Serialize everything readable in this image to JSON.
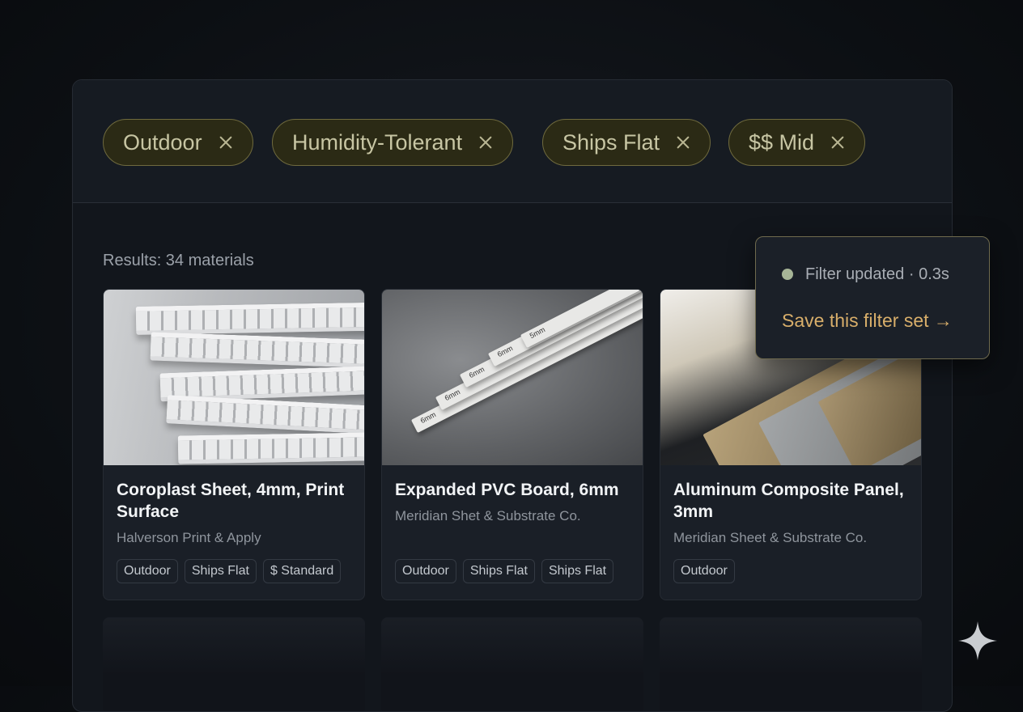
{
  "filters": {
    "chips": [
      {
        "label": "Outdoor"
      },
      {
        "label": "Humidity-Tolerant"
      },
      {
        "label": "Ships Flat"
      },
      {
        "label": "$$ Mid"
      }
    ]
  },
  "results": {
    "label": "Results: 34 materials",
    "cards": [
      {
        "title": "Coroplast Sheet, 4mm, Print Surface",
        "vendor": "Halverson Print & Apply",
        "tags": [
          "Outdoor",
          "Ships Flat",
          "$ Standard"
        ]
      },
      {
        "title": "Expanded PVC Board, 6mm",
        "vendor": "Meridian Shet & Substrate Co.",
        "tags": [
          "Outdoor",
          "Ships Flat",
          "Ships Flat"
        ],
        "board_marks": [
          "5mm",
          "6mm",
          "6mm",
          "6mm",
          "6mm"
        ]
      },
      {
        "title": "Aluminum Composite Panel, 3mm",
        "vendor": "Meridian Sheet & Substrate Co.",
        "tags": [
          "Outdoor"
        ]
      }
    ]
  },
  "toast": {
    "status": "Filter updated · 0.3s",
    "action": "Save this filter set →",
    "dot_color": "#a7b597"
  },
  "colors": {
    "chip_border": "#6f6a3e",
    "chip_bg": "#2b2a15",
    "accent": "#d8ae6a"
  }
}
